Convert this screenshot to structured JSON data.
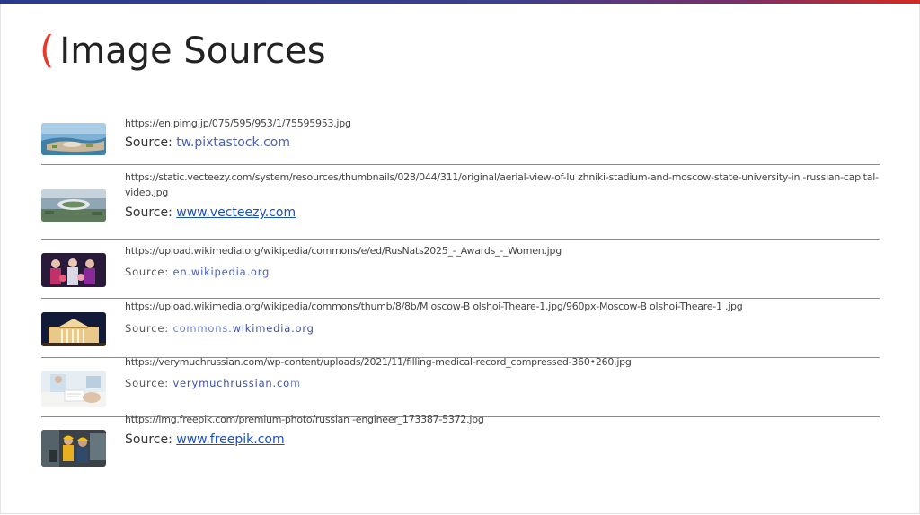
{
  "title": {
    "paren": "(",
    "text": "Image Sources"
  },
  "entries": [
    {
      "url": "https://en.pimg.jp/075/595/953/1/75595953.jpg",
      "source_label": "Source:",
      "source_link": "tw.pixtastock.com"
    },
    {
      "url": "https://static.vecteezy.com/system/resources/thumbnails/028/044/311/original/aerial-view-of-lu zhniki-stadium-and-moscow-state-university-in -russian-capital-video.jpg",
      "source_label": "Source:",
      "source_link": "www.vecteezy.com"
    },
    {
      "url": "https://upload.wikimedia.org/wikipedia/commons/e/ed/RusNats2025_-_Awards_-_Women.jpg",
      "source_label": "Source:",
      "source_link": "en.wikipedia.org"
    },
    {
      "url": "https://upload.wikimedia.org/wikipedia/commons/thumb/8/8b/M oscow-B olshoi-Theare-1.jpg/960px-Moscow-B olshoi-Theare-1 .jpg",
      "source_label": "Source:",
      "source_link_a": "commons.",
      "source_link_b": "wikimedia.org"
    },
    {
      "url": "https://verymuchrussian.com/wp-content/uploads/2021/11/filling-medical-record_compressed-360•260.jpg",
      "source_label": "Source:",
      "source_link_a": "verymuchrussian.co",
      "source_link_b": "m"
    },
    {
      "url": "https://img.freepik.com/premium-photo/russian -engineer_173387-5372.jpg",
      "source_label": "Source:",
      "source_link": "www.freepik.com"
    }
  ],
  "colors": {
    "accent_red": "#e53b2c",
    "link": "#1a4fbf",
    "link_light": "#4a62b5"
  }
}
